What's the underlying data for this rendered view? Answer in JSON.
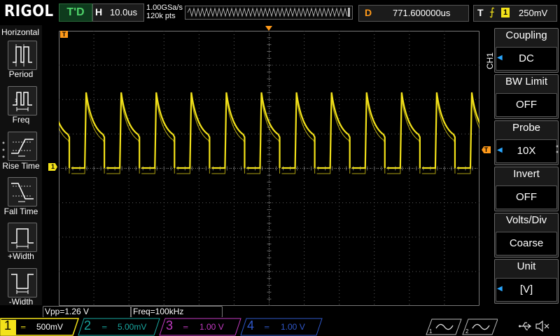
{
  "top": {
    "brand": "RIGOL",
    "run_status": "T'D",
    "horizontal_letter": "H",
    "timebase": "10.0us",
    "sample_rate": "1.00GSa/s",
    "memory_depth": "120k pts",
    "delay_letter": "D",
    "delay_value": "771.600000us",
    "trigger_letter": "T",
    "trigger_channel": "1",
    "trigger_level": "250mV"
  },
  "left_menu": {
    "title": "Horizontal",
    "items": [
      {
        "label": "Period",
        "icon": "period-icon"
      },
      {
        "label": "Freq",
        "icon": "freq-icon"
      },
      {
        "label": "Rise Time",
        "icon": "rise-time-icon"
      },
      {
        "label": "Fall Time",
        "icon": "fall-time-icon"
      },
      {
        "label": "+Width",
        "icon": "positive-width-icon"
      },
      {
        "label": "-Width",
        "icon": "negative-width-icon"
      }
    ]
  },
  "right_menu": {
    "channel": "CH1",
    "items": [
      {
        "title": "Coupling",
        "value": "DC",
        "has_arrow": true
      },
      {
        "title": "BW Limit",
        "value": "OFF",
        "has_arrow": false
      },
      {
        "title": "Probe",
        "value": "10X",
        "has_arrow": true
      },
      {
        "title": "Invert",
        "value": "OFF",
        "has_arrow": false
      },
      {
        "title": "Volts/Div",
        "value": "Coarse",
        "has_arrow": false
      },
      {
        "title": "Unit",
        "value": "[V]",
        "has_arrow": true
      }
    ]
  },
  "markers": {
    "trigger_position": "T",
    "channel_ground": "1",
    "trigger_level_marker": "T"
  },
  "measurements": [
    {
      "text": "Vpp=1.26 V"
    },
    {
      "text": "Freq=100kHz"
    }
  ],
  "channels": [
    {
      "num": "1",
      "scale": "500mV",
      "color": "#f3e21a",
      "active": true
    },
    {
      "num": "2",
      "scale": "5.00mV",
      "color": "#19a7a0",
      "active": false
    },
    {
      "num": "3",
      "scale": "1.00 V",
      "color": "#c23ac2",
      "active": false
    },
    {
      "num": "4",
      "scale": "1.00 V",
      "color": "#2f57c9",
      "active": false
    }
  ],
  "colors": {
    "ch1": "#f3e21a",
    "grid": "#5a5a5a",
    "trigger_orange": "#ff9a1a",
    "arrow_blue": "#2aa7ff"
  },
  "waveform": {
    "type": "pulse-train",
    "frequency": "100kHz",
    "period_divisions": 1
  }
}
